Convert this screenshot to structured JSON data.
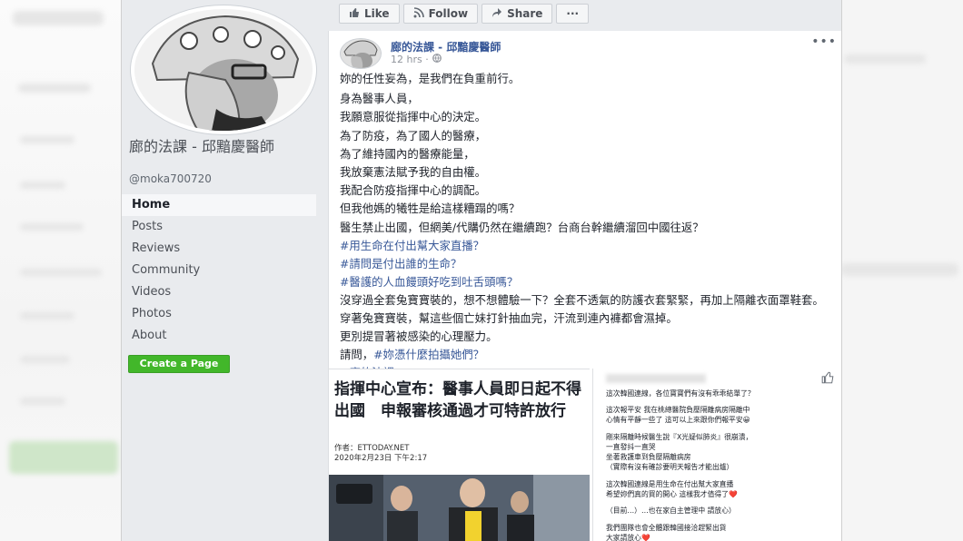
{
  "page": {
    "name": "廊的法課 - 邱黯慶醫師",
    "handle": "@moka700720",
    "nav": [
      "Home",
      "Posts",
      "Reviews",
      "Community",
      "Videos",
      "Photos",
      "About"
    ],
    "create_page": "Create a Page"
  },
  "actions": {
    "like": "Like",
    "follow": "Follow",
    "share": "Share",
    "more": "···"
  },
  "post": {
    "author": "廊的法課 - 邱黯慶醫師",
    "time": "12 hrs · ",
    "more": "•••",
    "lines": [
      "妳的任性妄為，是我們在負重前行。",
      "身為醫事人員，",
      "我願意服從指揮中心的決定。",
      "為了防疫，為了國人的醫療，",
      "為了維持國內的醫療能量，",
      "我放棄憲法賦予我的自由權。",
      "我配合防疫指揮中心的調配。",
      "但我他媽的犧牲是給這樣糟蹋的嗎？",
      "醫生禁止出國，但網美/代購仍然在繼續跑？台商台幹繼續溜回中國往返？",
      "#用生命在付出幫大家直播？",
      "#請問是付出誰的生命？",
      "#醫護的人血饅頭好吃到吐舌頭嗎？",
      "沒穿過全套兔寶寶裝的，想不想體驗一下？全套不透氣的防護衣套緊緊，再加上隔離衣面罩鞋套。",
      "穿著兔寶寶裝，幫這些個亡妹打針抽血完，汗流到連內褲都會濕掉。",
      "更別提冒著被感染的心理壓力。",
      "請問，",
      "#妳憑什麼拍攝她們？",
      "#廊的法課"
    ]
  },
  "news": {
    "headline": "指揮中心宣布：醫事人員即日起不得出國　申報審核通過才可特許放行",
    "author_line": "作者：ETTODAY.NET",
    "date_line": "2020年2月23日 下午2:17"
  },
  "chat": {
    "lines": [
      "這次韓國連線，各位寶寶們有沒有乖乖結單了？",
      "這次報平安 我在桃總醫院負壓隔離病房隔離中",
      "心情有平靜一些了 這可以上來跟你們報平安😀",
      "剛來隔離時候醫生說『X光疑似肺炎』很崩潰，",
      "一直發抖一直哭",
      "坐著救護車到負壓隔離病房",
      "（實際有沒有確診要明天報告才能出爐）",
      "這次韓國連線是用生命在付出幫大家直播",
      "希望妳們真的買的開心 這樣我才值得了❤️",
      "（目前…）…也在家自主管理中 請放心）",
      "我們團隊也會全體跟韓國接洽趕緊出貨",
      "大家請放心❤️"
    ]
  },
  "colors": {
    "link": "#385898",
    "green": "#42b72a",
    "page_bg": "#e9ebee"
  }
}
